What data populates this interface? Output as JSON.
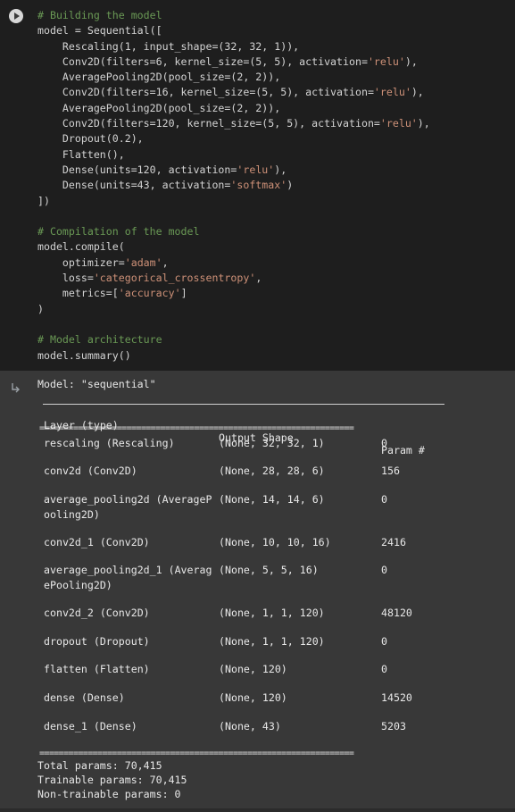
{
  "code_cell": {
    "lines": [
      {
        "parts": [
          {
            "t": "# Building the model",
            "k": "c"
          }
        ]
      },
      {
        "parts": [
          {
            "t": "model = Sequential([",
            "k": ""
          }
        ]
      },
      {
        "parts": [
          {
            "t": "    Rescaling(1, input_shape=(32, 32, 1)),",
            "k": ""
          }
        ]
      },
      {
        "parts": [
          {
            "t": "    Conv2D(filters=6, kernel_size=(5, 5), activation=",
            "k": ""
          },
          {
            "t": "'relu'",
            "k": "s"
          },
          {
            "t": "),",
            "k": ""
          }
        ]
      },
      {
        "parts": [
          {
            "t": "    AveragePooling2D(pool_size=(2, 2)),",
            "k": ""
          }
        ]
      },
      {
        "parts": [
          {
            "t": "    Conv2D(filters=16, kernel_size=(5, 5), activation=",
            "k": ""
          },
          {
            "t": "'relu'",
            "k": "s"
          },
          {
            "t": "),",
            "k": ""
          }
        ]
      },
      {
        "parts": [
          {
            "t": "    AveragePooling2D(pool_size=(2, 2)),",
            "k": ""
          }
        ]
      },
      {
        "parts": [
          {
            "t": "    Conv2D(filters=120, kernel_size=(5, 5), activation=",
            "k": ""
          },
          {
            "t": "'relu'",
            "k": "s"
          },
          {
            "t": "),",
            "k": ""
          }
        ]
      },
      {
        "parts": [
          {
            "t": "    Dropout(0.2),",
            "k": ""
          }
        ]
      },
      {
        "parts": [
          {
            "t": "    Flatten(),",
            "k": ""
          }
        ]
      },
      {
        "parts": [
          {
            "t": "    Dense(units=120, activation=",
            "k": ""
          },
          {
            "t": "'relu'",
            "k": "s"
          },
          {
            "t": "),",
            "k": ""
          }
        ]
      },
      {
        "parts": [
          {
            "t": "    Dense(units=43, activation=",
            "k": ""
          },
          {
            "t": "'softmax'",
            "k": "s"
          },
          {
            "t": ")",
            "k": ""
          }
        ]
      },
      {
        "parts": [
          {
            "t": "])",
            "k": ""
          }
        ]
      },
      {
        "parts": [
          {
            "t": "",
            "k": ""
          }
        ]
      },
      {
        "parts": [
          {
            "t": "# Compilation of the model",
            "k": "c"
          }
        ]
      },
      {
        "parts": [
          {
            "t": "model.compile(",
            "k": ""
          }
        ]
      },
      {
        "parts": [
          {
            "t": "    optimizer=",
            "k": ""
          },
          {
            "t": "'adam'",
            "k": "s"
          },
          {
            "t": ",",
            "k": ""
          }
        ]
      },
      {
        "parts": [
          {
            "t": "    loss=",
            "k": ""
          },
          {
            "t": "'categorical_crossentropy'",
            "k": "s"
          },
          {
            "t": ",",
            "k": ""
          }
        ]
      },
      {
        "parts": [
          {
            "t": "    metrics=[",
            "k": ""
          },
          {
            "t": "'accuracy'",
            "k": "s"
          },
          {
            "t": "]",
            "k": ""
          }
        ]
      },
      {
        "parts": [
          {
            "t": ")",
            "k": ""
          }
        ]
      },
      {
        "parts": [
          {
            "t": "",
            "k": ""
          }
        ]
      },
      {
        "parts": [
          {
            "t": "# Model architecture",
            "k": "c"
          }
        ]
      },
      {
        "parts": [
          {
            "t": "model.summary()",
            "k": ""
          }
        ]
      }
    ]
  },
  "output": {
    "model_title": "Model: \"sequential\"",
    "headers": [
      "Layer (type)",
      "Output Shape",
      "Param #"
    ],
    "rows": [
      {
        "layer": "rescaling (Rescaling)",
        "shape": "(None, 32, 32, 1)",
        "params": "0"
      },
      {
        "layer": "conv2d (Conv2D)",
        "shape": "(None, 28, 28, 6)",
        "params": "156"
      },
      {
        "layer": "average_pooling2d (AverageP\nooling2D)",
        "shape": "(None, 14, 14, 6)",
        "params": "0"
      },
      {
        "layer": "conv2d_1 (Conv2D)",
        "shape": "(None, 10, 10, 16)",
        "params": "2416"
      },
      {
        "layer": "average_pooling2d_1 (Averag\nePooling2D)",
        "shape": "(None, 5, 5, 16)",
        "params": "0"
      },
      {
        "layer": "conv2d_2 (Conv2D)",
        "shape": "(None, 1, 1, 120)",
        "params": "48120"
      },
      {
        "layer": "dropout (Dropout)",
        "shape": "(None, 1, 1, 120)",
        "params": "0"
      },
      {
        "layer": "flatten (Flatten)",
        "shape": "(None, 120)",
        "params": "0"
      },
      {
        "layer": "dense (Dense)",
        "shape": "(None, 120)",
        "params": "14520"
      },
      {
        "layer": "dense_1 (Dense)",
        "shape": "(None, 43)",
        "params": "5203"
      }
    ],
    "separator": "=================================================================",
    "total_params": "Total params: 70,415",
    "trainable_params": "Trainable params: 70,415",
    "non_trainable_params": "Non-trainable params: 0"
  },
  "icons": {
    "run": "play-icon",
    "output": "output-arrow-icon"
  }
}
